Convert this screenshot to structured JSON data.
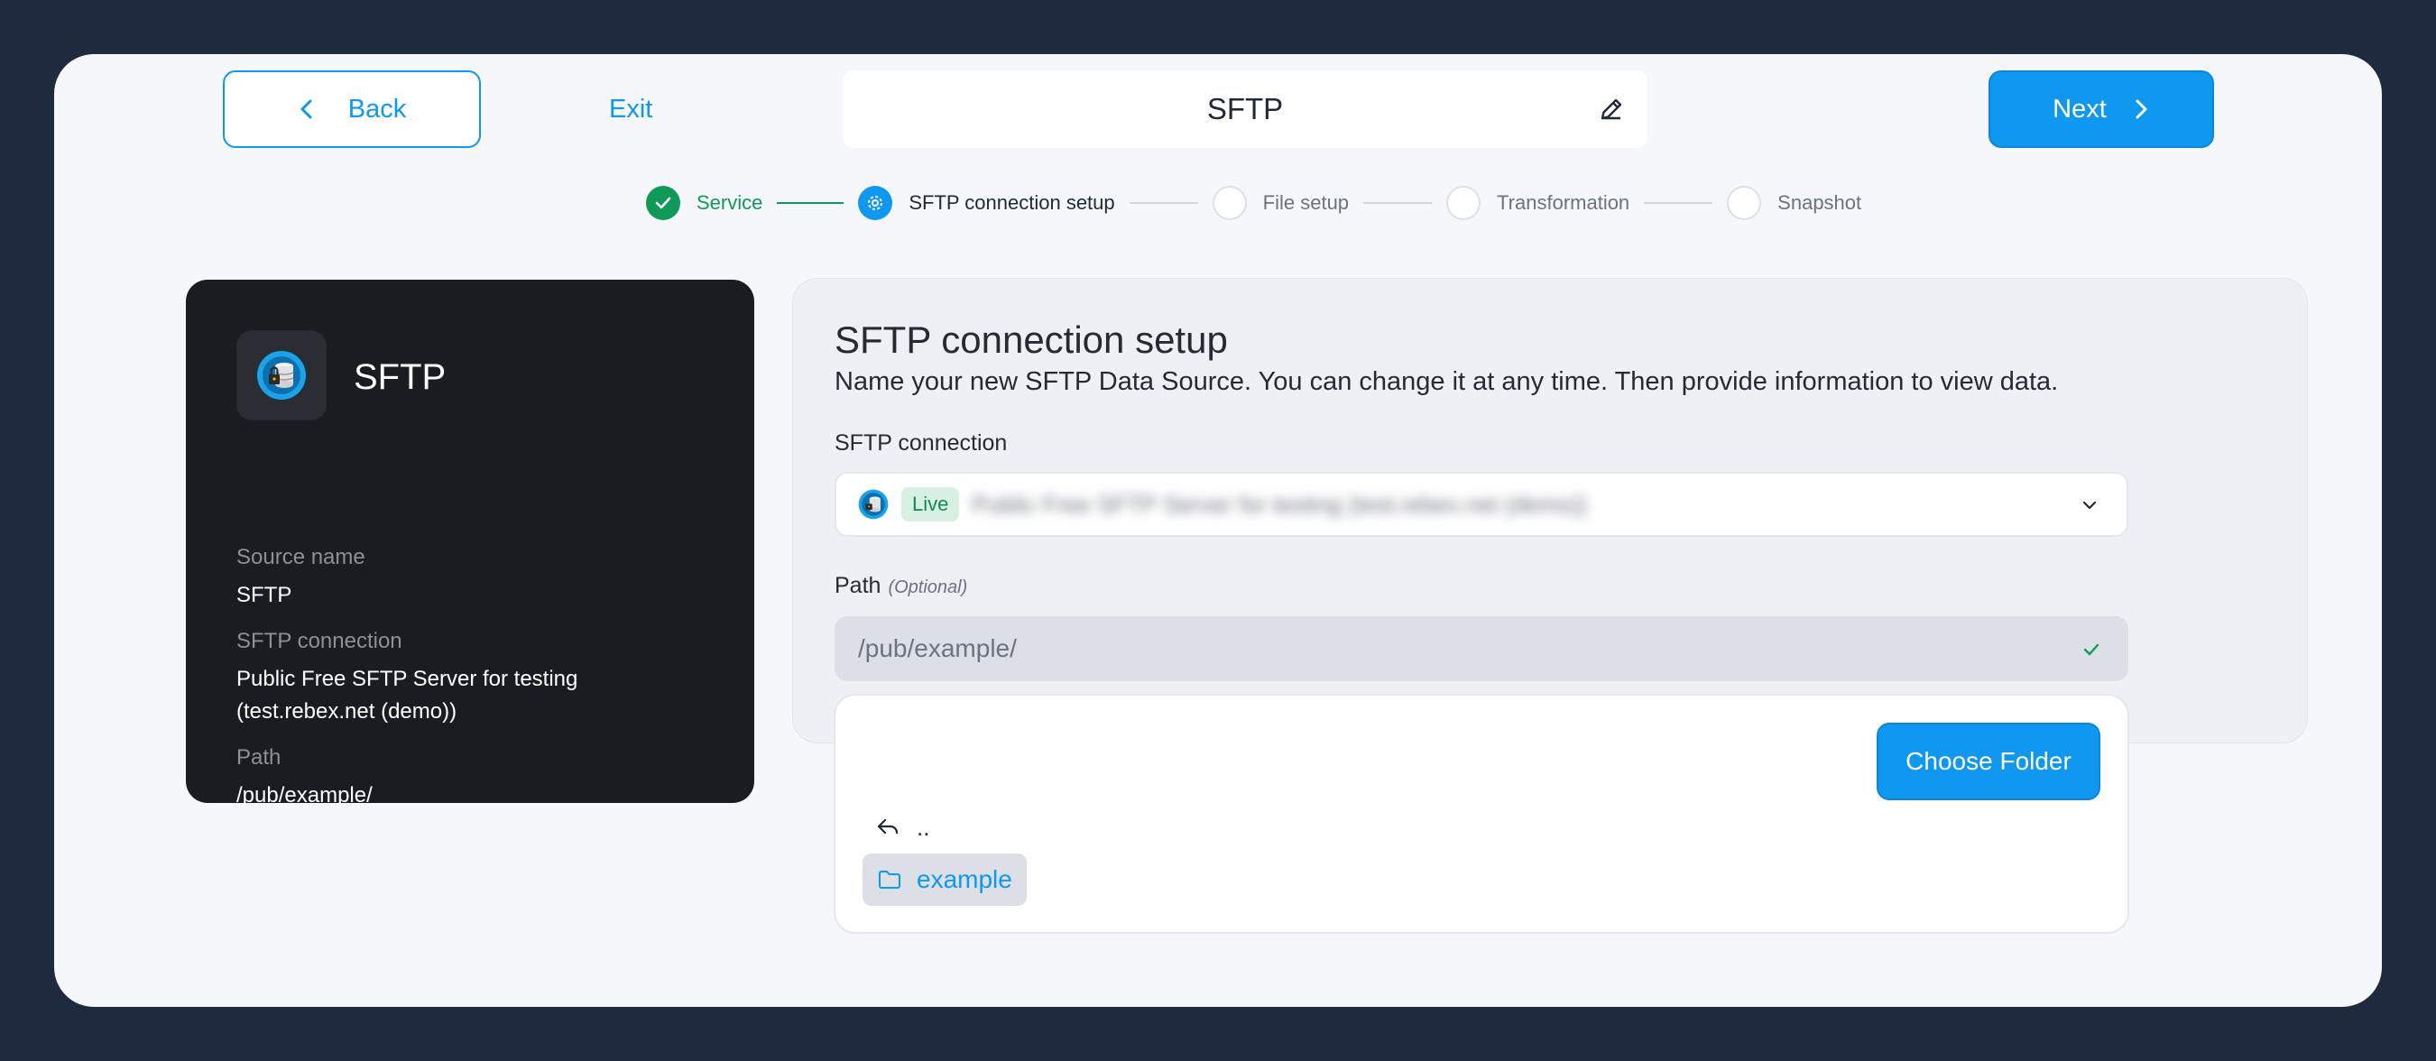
{
  "header": {
    "back_label": "Back",
    "exit_label": "Exit",
    "title": "SFTP",
    "next_label": "Next"
  },
  "stepper": {
    "steps": [
      {
        "label": "Service",
        "state": "done"
      },
      {
        "label": "SFTP connection setup",
        "state": "active"
      },
      {
        "label": "File setup",
        "state": "pending"
      },
      {
        "label": "Transformation",
        "state": "pending"
      },
      {
        "label": "Snapshot",
        "state": "pending"
      }
    ]
  },
  "summary": {
    "title": "SFTP",
    "source_name_label": "Source name",
    "source_name_value": "SFTP",
    "connection_label": "SFTP connection",
    "connection_value": "Public Free SFTP Server for testing (test.rebex.net (demo))",
    "path_label": "Path",
    "path_value": "/pub/example/"
  },
  "form": {
    "title": "SFTP connection setup",
    "description": "Name your new SFTP Data Source. You can change it at any time. Then provide information to view data.",
    "connection_label": "SFTP connection",
    "connection_status": "Live",
    "connection_value": "Public Free SFTP Server for testing (test.rebex.net (demo))",
    "path_label": "Path",
    "path_optional": "(Optional)",
    "path_value": "/pub/example/"
  },
  "browser": {
    "choose_label": "Choose Folder",
    "parent_label": "..",
    "folders": [
      "example"
    ]
  },
  "colors": {
    "accent": "#1098f0",
    "success": "#0f9a59",
    "frame": "#1e2a3d",
    "card_dark": "#1a1c21"
  }
}
